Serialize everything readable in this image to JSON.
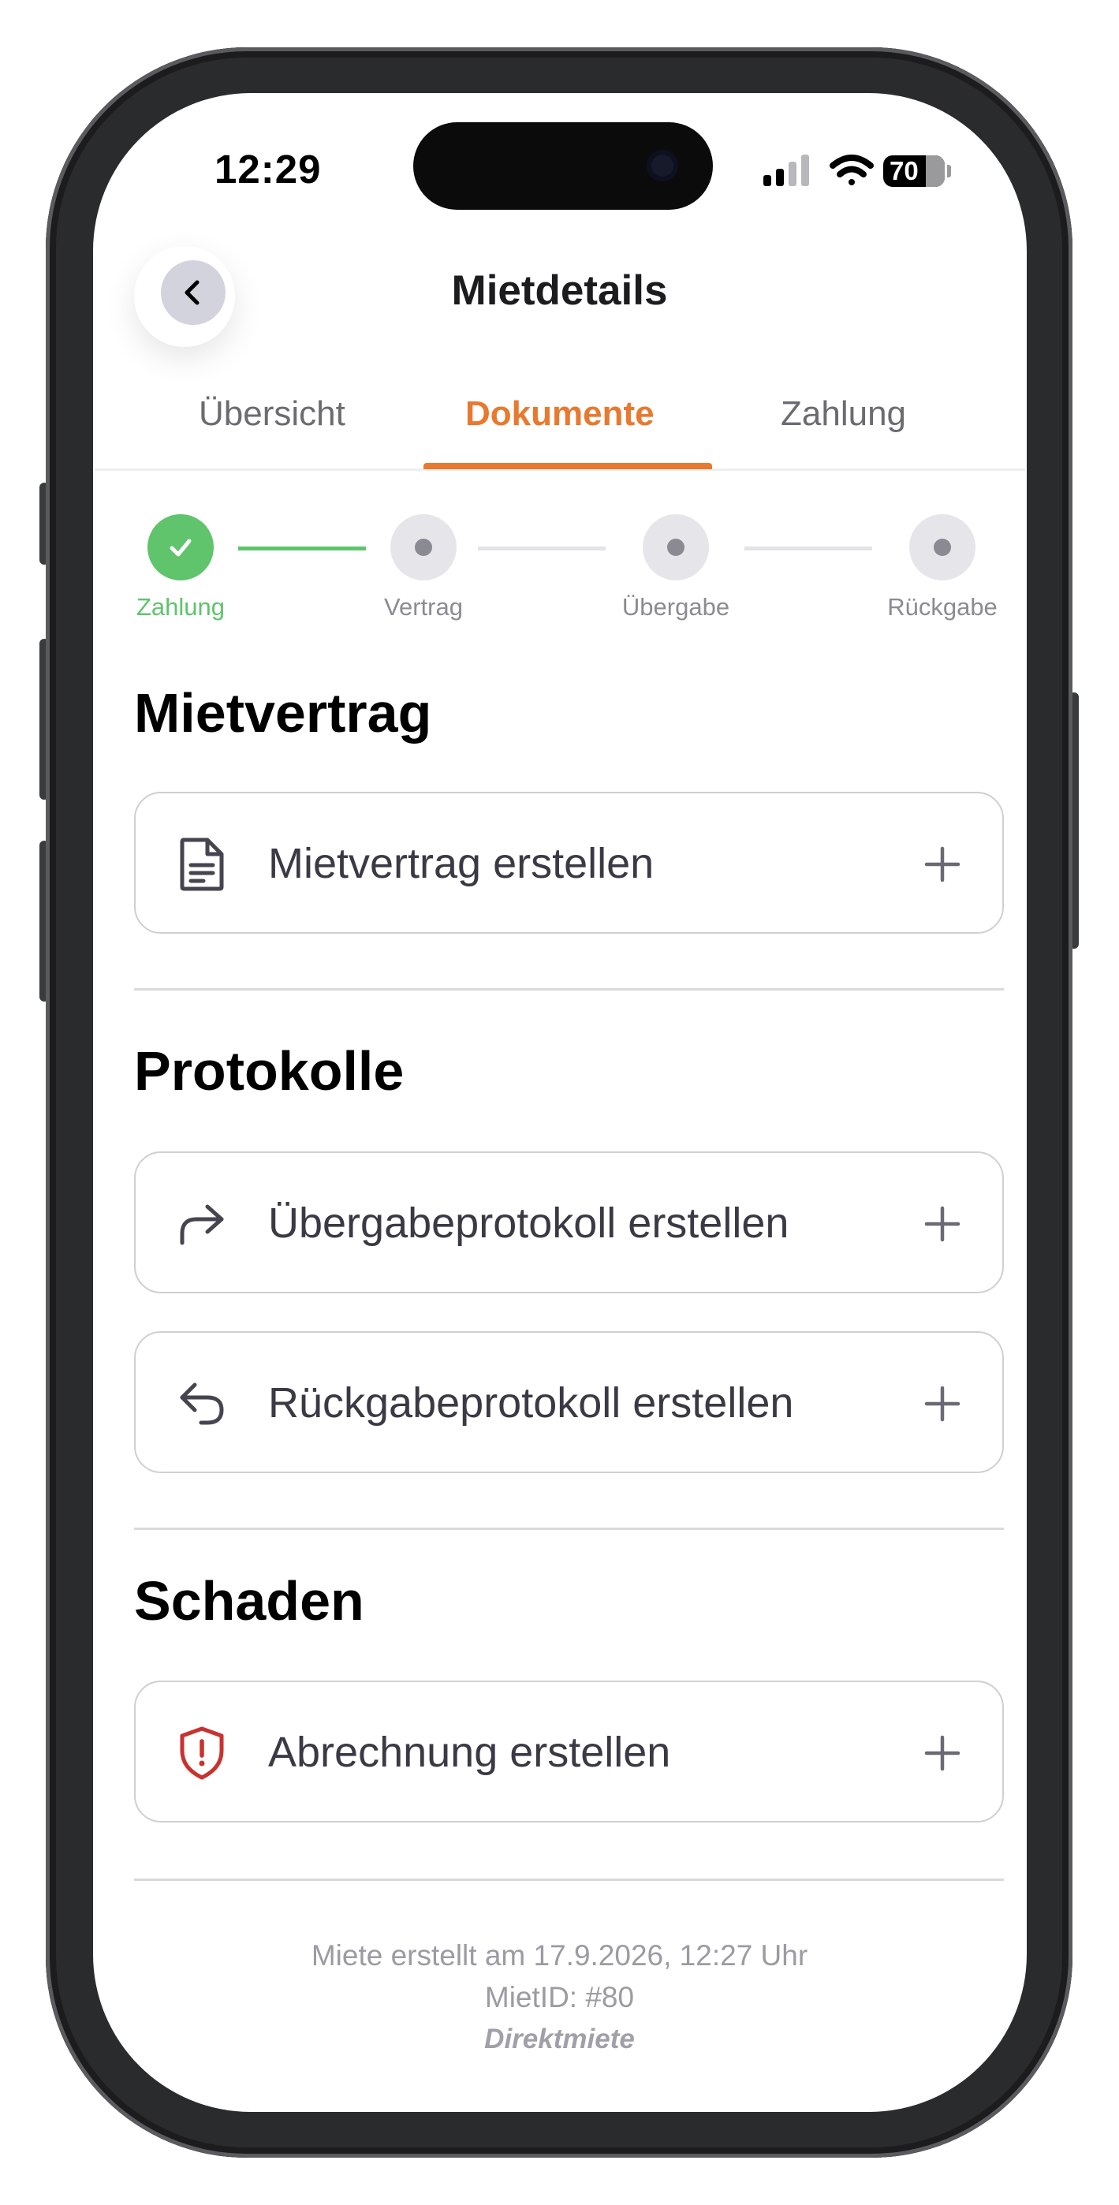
{
  "status_bar": {
    "time": "12:29",
    "battery": "70"
  },
  "header": {
    "title": "Mietdetails"
  },
  "tabs": [
    {
      "label": "Übersicht",
      "active": false
    },
    {
      "label": "Dokumente",
      "active": true
    },
    {
      "label": "Zahlung",
      "active": false
    }
  ],
  "stepper": [
    {
      "label": "Zahlung",
      "done": true
    },
    {
      "label": "Vertrag",
      "done": false
    },
    {
      "label": "Übergabe",
      "done": false
    },
    {
      "label": "Rückgabe",
      "done": false
    }
  ],
  "sections": {
    "mietvertrag": {
      "title": "Mietvertrag",
      "items": [
        {
          "label": "Mietvertrag erstellen",
          "icon": "document-icon"
        }
      ]
    },
    "protokolle": {
      "title": "Protokolle",
      "items": [
        {
          "label": "Übergabeprotokoll erstellen",
          "icon": "arrow-forward-icon"
        },
        {
          "label": "Rückgabeprotokoll erstellen",
          "icon": "arrow-return-icon"
        }
      ]
    },
    "schaden": {
      "title": "Schaden",
      "items": [
        {
          "label": "Abrechnung erstellen",
          "icon": "shield-alert-icon"
        }
      ]
    }
  },
  "footer": {
    "created": "Miete erstellt am 17.9.2026, 12:27 Uhr",
    "rent_id": "MietID: #80",
    "type": "Direktmiete"
  },
  "colors": {
    "accent": "#e8792f",
    "success": "#5fc46b",
    "danger": "#c8322f"
  }
}
